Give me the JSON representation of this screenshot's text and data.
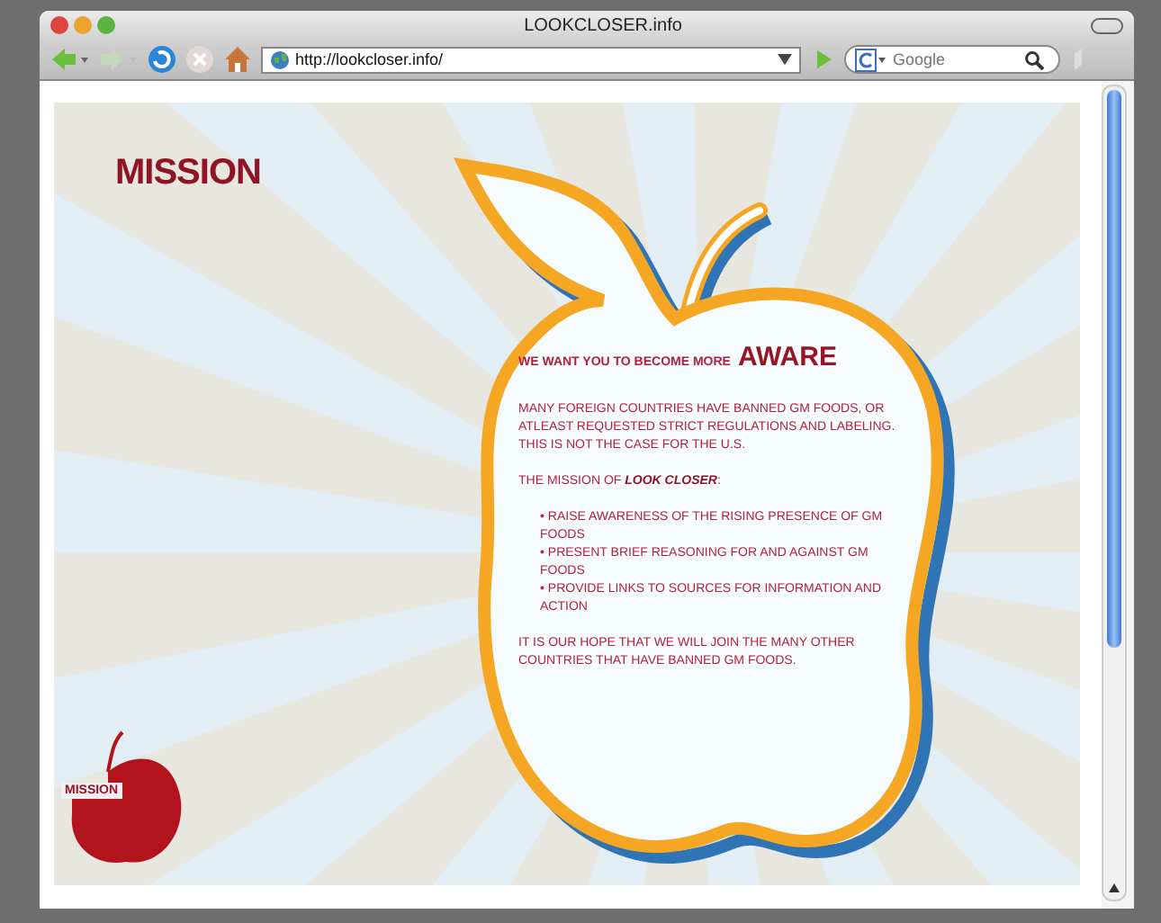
{
  "window": {
    "title": "LOOKCLOSER.info"
  },
  "toolbar": {
    "address": "http://lookcloser.info/",
    "search": {
      "placeholder": "Google"
    }
  },
  "page": {
    "heading": "MISSION",
    "intro": "WE WANT YOU TO BECOME MORE",
    "intro_emphasis": "AWARE",
    "paragraphs": [
      "MANY FOREIGN COUNTRIES HAVE BANNED GM FOODS, OR ATLEAST REQUESTED STRICT REGULATIONS AND LABELING.  THIS IS NOT THE CASE FOR THE U.S."
    ],
    "mission_line": "THE MISSION OF **LOOK CLOSER**:",
    "bullets": [
      "• RAISE AWARENESS OF THE RISING PRESENCE OF GM FOODS",
      "• PRESENT BRIEF REASONING FOR AND AGAINST GM FOODS",
      "• PROVIDE LINKS TO SOURCES FOR INFORMATION AND ACTION"
    ],
    "closing": "IT IS OUR HOPE THAT WE WILL JOIN THE MANY OTHER COUNTRIES THAT HAVE BANNED GM FOODS.",
    "nav_badge": "MISSION"
  }
}
